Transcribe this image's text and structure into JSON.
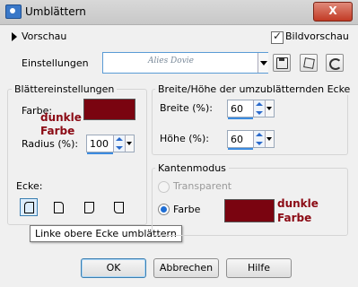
{
  "window": {
    "title": "Umblättern",
    "close_label": "X"
  },
  "preview": {
    "label": "Vorschau",
    "checkbox_label": "Bildvorschau"
  },
  "settings": {
    "label": "Einstellungen",
    "value": "Alies Dovie"
  },
  "sheet": {
    "title": "Blättereinstellungen",
    "color_label": "Farbe:",
    "color_value": "#7a0410",
    "color_note_line1": "dunkle",
    "color_note_line2": "Farbe",
    "radius_label": "Radius (%):",
    "radius_value": "100",
    "corner_label": "Ecke:"
  },
  "size": {
    "title": "Breite/Höhe der umzublätternden Ecke",
    "width_label": "Breite (%):",
    "width_value": "60",
    "height_label": "Höhe (%):",
    "height_value": "60"
  },
  "edge": {
    "title": "Kantenmodus",
    "transparent_label": "Transparent",
    "color_label": "Farbe",
    "color_value": "#7a0410",
    "color_note_line1": "dunkle",
    "color_note_line2": "Farbe"
  },
  "tooltip": "Linke obere Ecke umblättern",
  "buttons": {
    "ok": "OK",
    "reset": "Abbrechen",
    "help": "Hilfe"
  }
}
